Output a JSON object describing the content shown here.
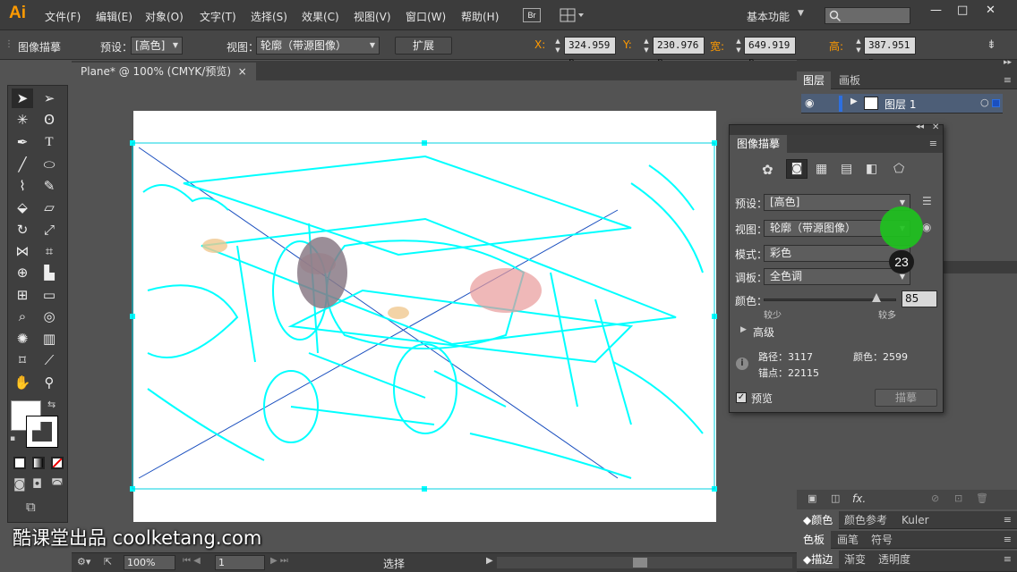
{
  "app": {
    "logo": "Ai"
  },
  "menus": [
    "文件(F)",
    "编辑(E)",
    "对象(O)",
    "文字(T)",
    "选择(S)",
    "效果(C)",
    "视图(V)",
    "窗口(W)",
    "帮助(H)"
  ],
  "bridge": "Br",
  "workspace": "基本功能",
  "control": {
    "title": "图像描摹",
    "preset_label": "预设：",
    "preset_value": "[高色]",
    "view_label": "视图：",
    "view_value": "轮廓（带源图像）",
    "expand_button": "扩展",
    "x_label": "X:",
    "x_value": "324.959 p",
    "y_label": "Y:",
    "y_value": "230.976 p",
    "w_label": "宽:",
    "w_value": "649.919 p",
    "h_label": "高:",
    "h_value": "387.951 p"
  },
  "document": {
    "tab_title": "Plane* @ 100% (CMYK/预览)",
    "close": "×"
  },
  "status": {
    "zoom": "100%",
    "page": "1",
    "tool": "选择"
  },
  "right_panels": {
    "layers_tabs": [
      "图层",
      "画板"
    ],
    "layer_name": "图层 1",
    "bottom_tabs_1": [
      "颜色",
      "颜色参考",
      "Kuler"
    ],
    "bottom_tabs_2": [
      "色板",
      "画笔",
      "符号"
    ],
    "bottom_tabs_3": [
      "描边",
      "渐变",
      "透明度"
    ],
    "fx": "fx."
  },
  "image_trace": {
    "title": "图像描摹",
    "preset_label": "预设：",
    "preset_value": "[高色]",
    "view_label": "视图：",
    "view_value": "轮廓（带源图像）",
    "mode_label": "模式：",
    "mode_value": "彩色",
    "palette_label": "调板：",
    "palette_value": "全色调",
    "colors_label": "颜色：",
    "colors_value": "85",
    "colors_level": 0.85,
    "less": "较少",
    "more": "较多",
    "advanced": "高级",
    "paths_label": "路径：3117",
    "anchors_label": "锚点：22115",
    "colors_count": "颜色：2599",
    "preview_label": "预览",
    "trace_button": "描摹"
  },
  "overlay": {
    "step_badge": "23",
    "watermark": "酷课堂出品 coolketang.com"
  },
  "colors": {
    "trace_outline": "#00ffff",
    "accent": "#ff9a00",
    "cursor": "#1ec21e"
  }
}
